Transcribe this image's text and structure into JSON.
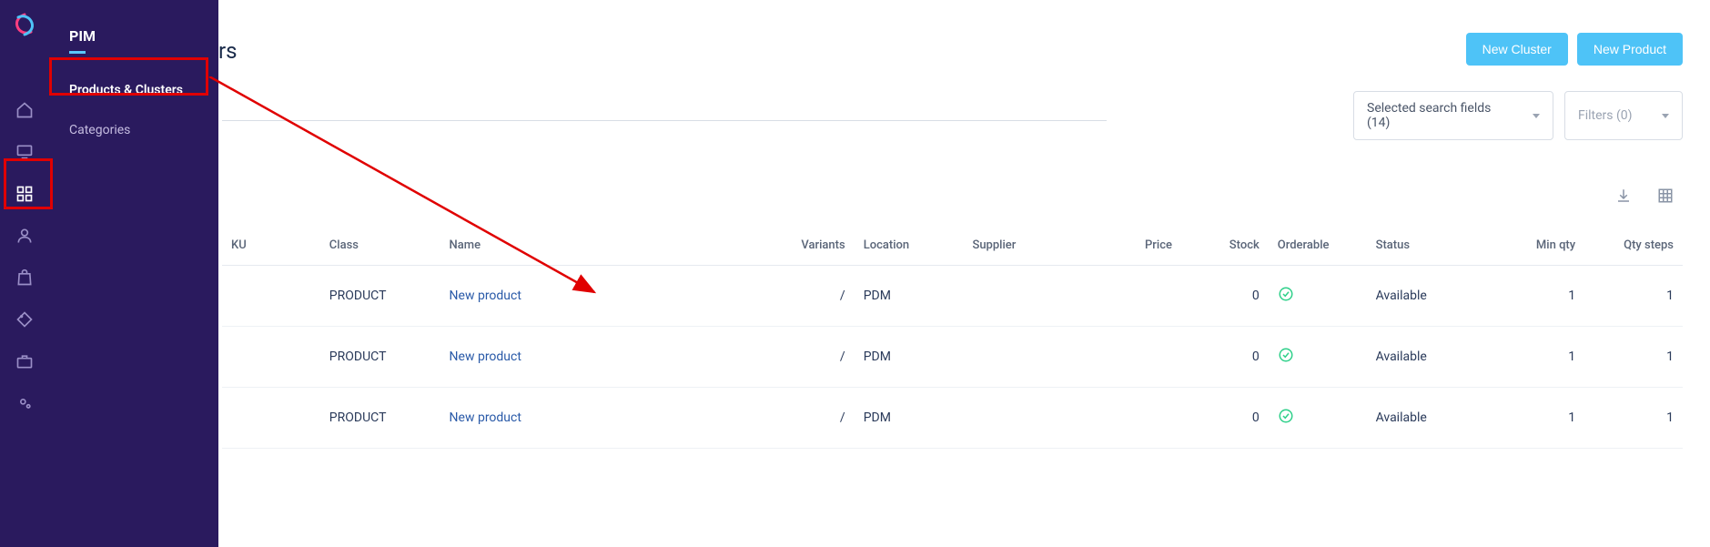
{
  "flyout": {
    "title": "PIM",
    "items": [
      {
        "label": "Products & Clusters",
        "active": true
      },
      {
        "label": "Categories",
        "active": false
      }
    ]
  },
  "header": {
    "title_partial": "rs",
    "actions": {
      "new_cluster": "New Cluster",
      "new_product": "New Product"
    }
  },
  "filters": {
    "selected_fields": "Selected search fields (14)",
    "filters_label": "Filters (0)"
  },
  "table": {
    "headers": {
      "sku": "KU",
      "class": "Class",
      "name": "Name",
      "variants": "Variants",
      "location": "Location",
      "supplier": "Supplier",
      "price": "Price",
      "stock": "Stock",
      "orderable": "Orderable",
      "status": "Status",
      "min_qty": "Min qty",
      "qty_steps": "Qty steps"
    },
    "rows": [
      {
        "class": "PRODUCT",
        "name": "New product",
        "variants": "/",
        "location": "PDM",
        "supplier": "",
        "price": "",
        "stock": "0",
        "status": "Available",
        "min_qty": "1",
        "qty_steps": "1"
      },
      {
        "class": "PRODUCT",
        "name": "New product",
        "variants": "/",
        "location": "PDM",
        "supplier": "",
        "price": "",
        "stock": "0",
        "status": "Available",
        "min_qty": "1",
        "qty_steps": "1"
      },
      {
        "class": "PRODUCT",
        "name": "New product",
        "variants": "/",
        "location": "PDM",
        "supplier": "",
        "price": "",
        "stock": "0",
        "status": "Available",
        "min_qty": "1",
        "qty_steps": "1"
      }
    ]
  }
}
